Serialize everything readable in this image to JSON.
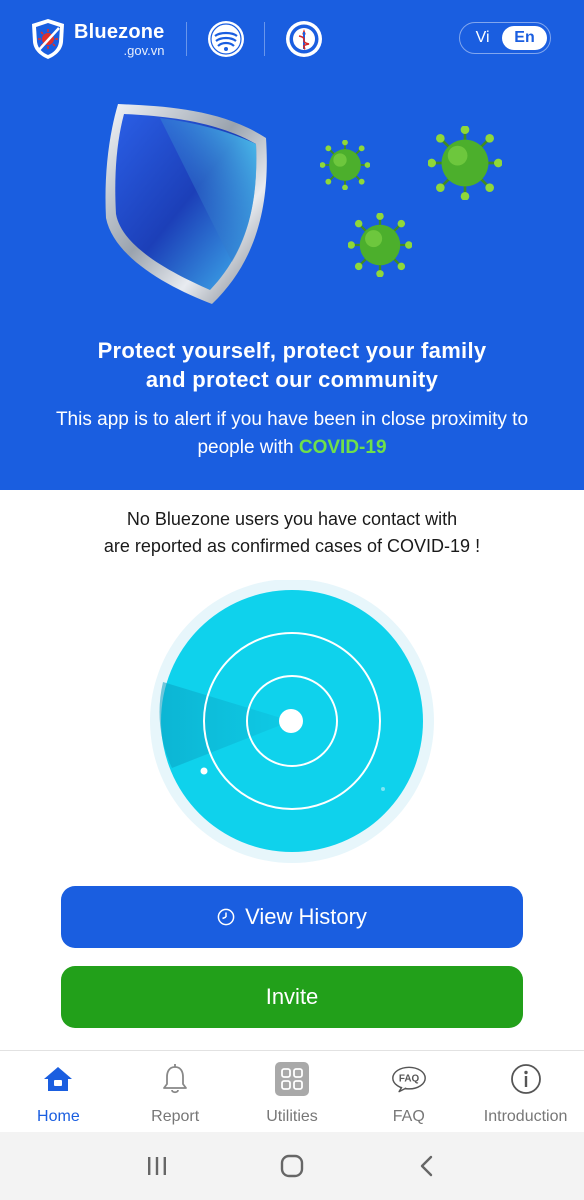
{
  "header": {
    "brand_name": "Bluezone",
    "brand_domain": ".gov.vn",
    "language_options": [
      "Vi",
      "En"
    ],
    "language_selected": "En"
  },
  "hero": {
    "title_line1": "Protect yourself, protect your family",
    "title_line2": "and protect our community",
    "subtitle_line1": "This app is to alert if you have been in close proximity to",
    "subtitle_line2_prefix": "people with ",
    "subtitle_highlight": "COVID-19"
  },
  "status": {
    "line1": "No Bluezone users you have contact with",
    "line2": "are reported as confirmed cases of COVID-19 !"
  },
  "actions": {
    "view_history_label": "View History",
    "invite_label": "Invite"
  },
  "bottom_nav": {
    "items": [
      {
        "label": "Home",
        "icon": "home-icon",
        "active": true
      },
      {
        "label": "Report",
        "icon": "bell-icon",
        "active": false
      },
      {
        "label": "Utilities",
        "icon": "grid-icon",
        "active": false
      },
      {
        "label": "FAQ",
        "icon": "faq-icon",
        "active": false
      },
      {
        "label": "Introduction",
        "icon": "info-icon",
        "active": false
      }
    ]
  },
  "system_nav": [
    "recent-apps-icon",
    "home-circle-icon",
    "back-icon"
  ],
  "colors": {
    "brand_blue": "#1a5ee0",
    "invite_green": "#22a01a",
    "covid_highlight": "#6fe04a",
    "radar_cyan": "#0fd2ec"
  }
}
